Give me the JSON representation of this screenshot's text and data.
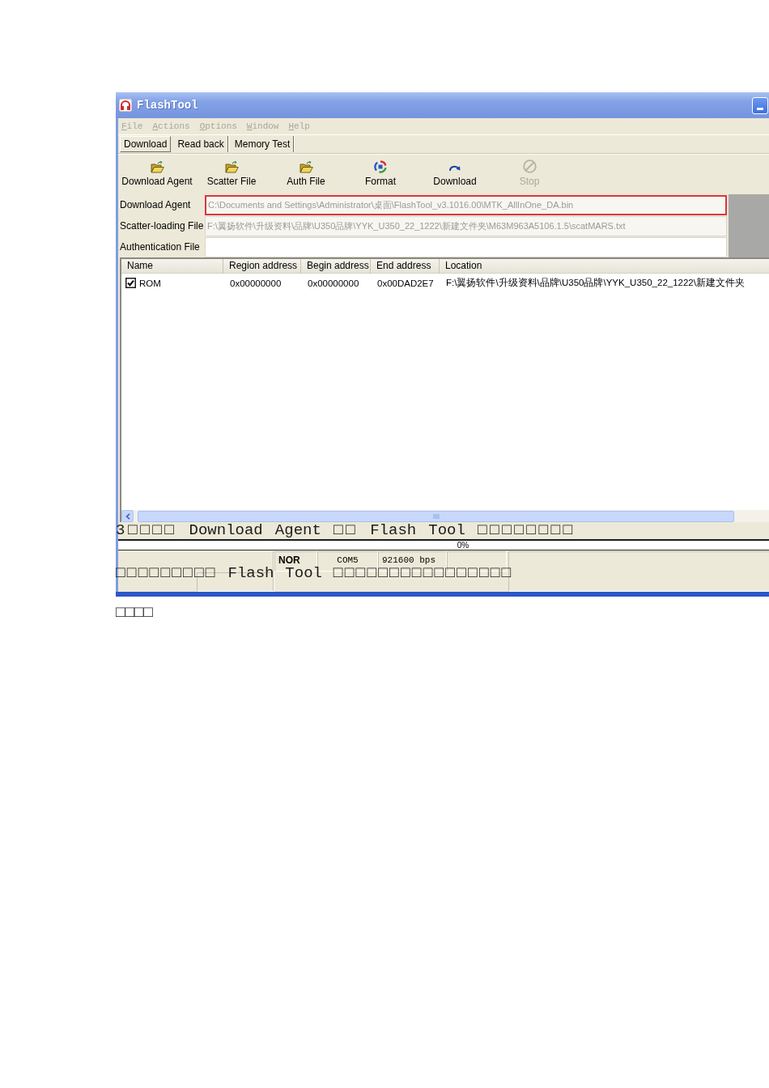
{
  "window": {
    "title": "FlashTool"
  },
  "menu": [
    {
      "label": "File",
      "disabled": true
    },
    {
      "label": "Actions",
      "disabled": true
    },
    {
      "label": "Options",
      "disabled": true
    },
    {
      "label": "Window",
      "disabled": true
    },
    {
      "label": "Help",
      "disabled": true
    }
  ],
  "tabs": [
    {
      "label": "Download",
      "selected": true
    },
    {
      "label": "Read back",
      "selected": false
    },
    {
      "label": "Memory Test",
      "selected": false
    }
  ],
  "toolbar": [
    {
      "label": "Download Agent",
      "kind": "folder",
      "disabled": false
    },
    {
      "label": "Scatter File",
      "kind": "folder",
      "disabled": false
    },
    {
      "label": "Auth File",
      "kind": "folder",
      "disabled": false
    },
    {
      "label": "Format",
      "kind": "format",
      "disabled": false
    },
    {
      "label": "Download",
      "kind": "download",
      "disabled": false
    },
    {
      "label": "Stop",
      "kind": "stop",
      "disabled": true
    }
  ],
  "fields": [
    {
      "label": "Download Agent",
      "value": "C:\\Documents and Settings\\Administrator\\桌面\\FlashTool_v3.1016.00\\MTK_AllInOne_DA.bin",
      "highlighted": true
    },
    {
      "label": "Scatter-loading File",
      "value": "F:\\翼扬软件\\升级资料\\品牌\\U350品牌\\YYK_U350_22_1222\\新建文件夹\\M63M963A5106.1.5\\scatMARS.txt",
      "highlighted": false
    },
    {
      "label": "Authentication File",
      "highlighted": false
    }
  ],
  "table": {
    "columns": [
      "Name",
      "Region address",
      "Begin address",
      "End address",
      "Location"
    ],
    "rows": [
      {
        "checked": true,
        "cells": [
          "ROM",
          "0x00000000",
          "0x00000000",
          "0x00DAD2E7",
          "F:\\翼扬软件\\升级资料\\品牌\\U350品牌\\YYK_U350_22_1222\\新建文件夹"
        ]
      }
    ]
  },
  "progress": {
    "level": 0,
    "text": "0%"
  },
  "status_bar": [
    {
      "kind": "mode",
      "text": "NOR"
    },
    {
      "kind": "port",
      "text": "COM5"
    },
    {
      "kind": "speed",
      "text": "921600 bps"
    }
  ],
  "document_text": [
    "3□□□□ Download Agent □□ Flash Tool □□□□□□□□",
    "□□□□□□□□□ Flash Tool □□□□□□□□□□□□□□□□",
    "□□□□"
  ]
}
